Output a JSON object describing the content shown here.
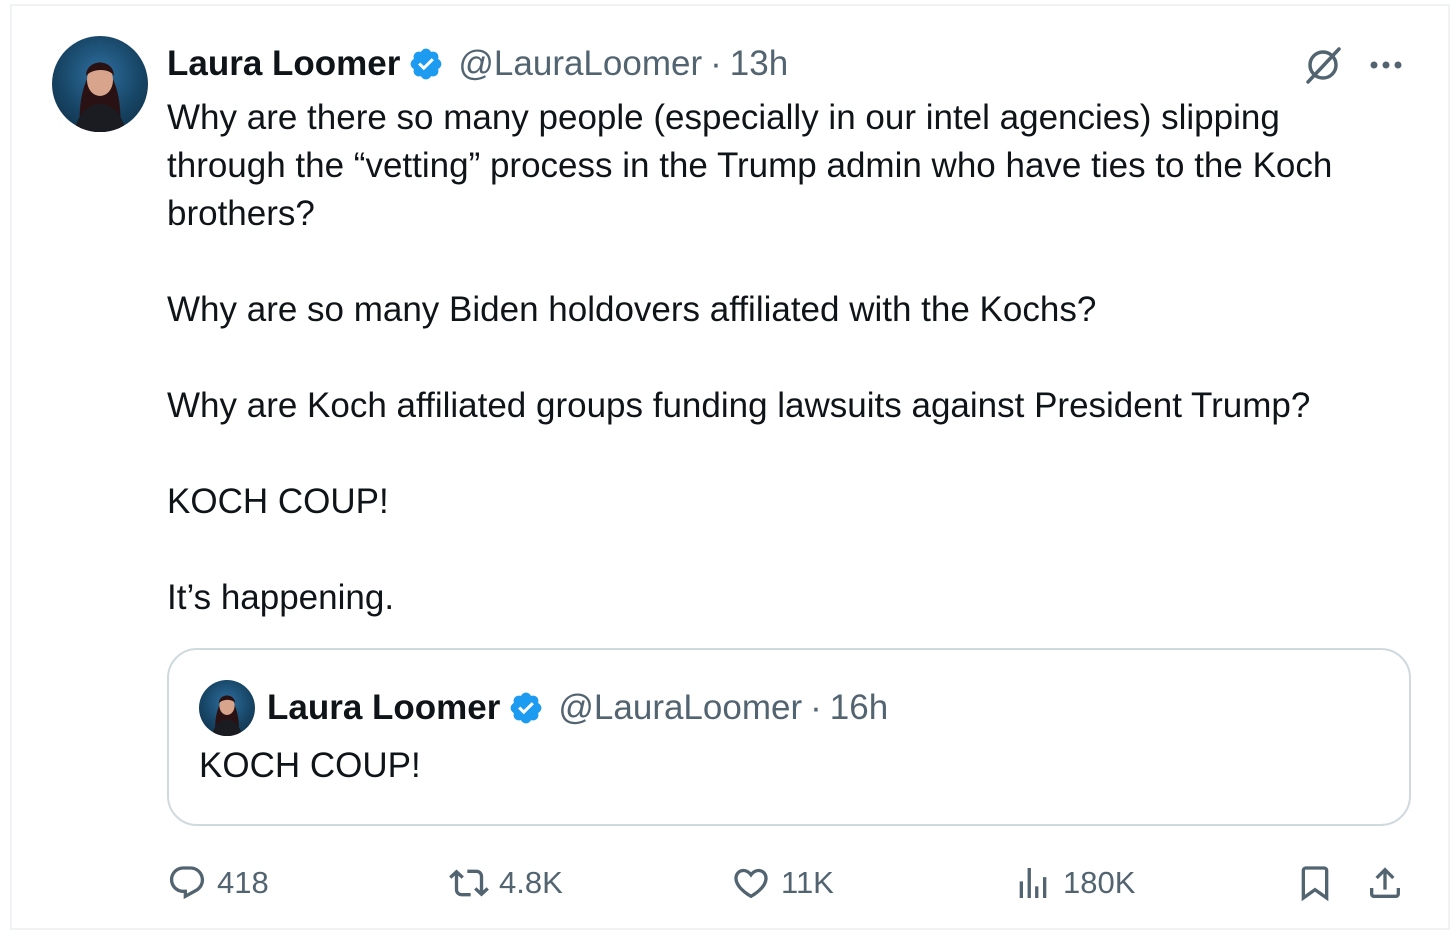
{
  "tweet": {
    "author_name": "Laura Loomer",
    "handle": "@LauraLoomer",
    "separator": "·",
    "time": "13h",
    "paragraphs": [
      "Why are there so many people (especially in our intel agencies) slipping through the “vetting” process in the Trump admin who have ties to the Koch brothers?",
      "Why are so many Biden holdovers affiliated with the Kochs?",
      "Why are Koch affiliated groups funding lawsuits against President Trump?",
      "KOCH COUP!",
      "It’s happening."
    ]
  },
  "quoted_tweet": {
    "author_name": "Laura Loomer",
    "handle": "@LauraLoomer",
    "separator": "·",
    "time": "16h",
    "text": "KOCH COUP!"
  },
  "actions": {
    "replies": "418",
    "reposts": "4.8K",
    "likes": "11K",
    "views": "180K"
  },
  "icons": {
    "verified": "verified-badge-icon",
    "grok": "grok-icon",
    "more": "more-icon",
    "reply": "reply-icon",
    "repost": "repost-icon",
    "like": "heart-icon",
    "views": "views-icon",
    "bookmark": "bookmark-icon",
    "share": "share-icon"
  },
  "colors": {
    "text_primary": "#0f1419",
    "text_secondary": "#536471",
    "verified_blue": "#1d9bf0",
    "border": "#cfd9de"
  }
}
